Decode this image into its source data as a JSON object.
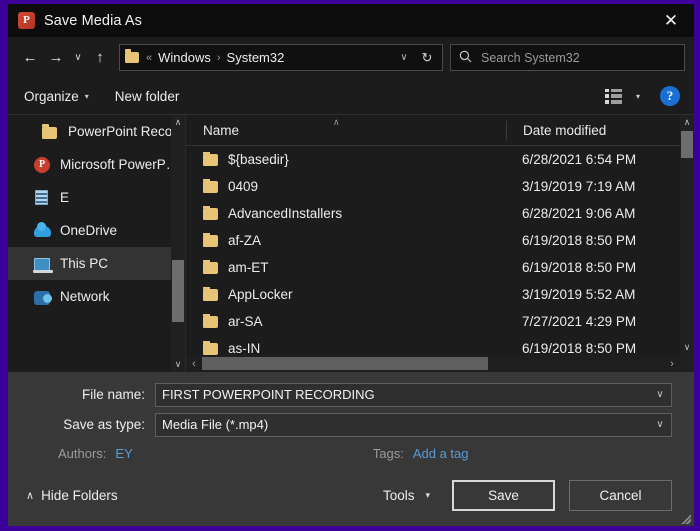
{
  "window": {
    "title": "Save Media As",
    "app_icon": "powerpoint-icon",
    "app_icon_letter": "P",
    "close_label": "✕",
    "accent_border": "#3d0099"
  },
  "nav": {
    "back": "←",
    "forward": "→",
    "recent": "∨",
    "up": "↑",
    "address": {
      "folder_icon": "folder-icon",
      "separator_first": "«",
      "separator": "›",
      "crumbs": [
        "Windows",
        "System32"
      ],
      "dropdown": "∨",
      "refresh": "↻"
    },
    "search": {
      "icon": "search-icon",
      "placeholder": "Search System32",
      "value": ""
    }
  },
  "toolbar": {
    "organize_label": "Organize",
    "organize_caret": "▾",
    "new_folder_label": "New folder",
    "view_icon": "list-view-icon",
    "view_caret": "▾",
    "help_label": "?"
  },
  "sidebar": {
    "scroll_up": "∧",
    "scroll_down": "∨",
    "items": [
      {
        "label": "PowerPoint Reco",
        "icon": "folder-icon",
        "selected": false,
        "chevron": "∧"
      },
      {
        "label": "Microsoft PowerP…",
        "icon": "powerpoint-icon",
        "selected": false,
        "chevron": ""
      },
      {
        "label": "E",
        "icon": "network-drive-icon",
        "selected": false,
        "chevron": ""
      },
      {
        "label": "OneDrive",
        "icon": "onedrive-icon",
        "selected": false,
        "chevron": ""
      },
      {
        "label": "This PC",
        "icon": "this-pc-icon",
        "selected": true,
        "chevron": ""
      },
      {
        "label": "Network",
        "icon": "network-icon",
        "selected": false,
        "chevron": ""
      }
    ]
  },
  "filelist": {
    "columns": [
      "Name",
      "Date modified"
    ],
    "sort_indicator": "∧",
    "rows": [
      {
        "name": "${basedir}",
        "date": "6/28/2021 6:54 PM"
      },
      {
        "name": "0409",
        "date": "3/19/2019 7:19 AM"
      },
      {
        "name": "AdvancedInstallers",
        "date": "6/28/2021 9:06 AM"
      },
      {
        "name": "af-ZA",
        "date": "6/19/2018 8:50 PM"
      },
      {
        "name": "am-ET",
        "date": "6/19/2018 8:50 PM"
      },
      {
        "name": "AppLocker",
        "date": "3/19/2019 5:52 AM"
      },
      {
        "name": "ar-SA",
        "date": "7/27/2021 4:29 PM"
      },
      {
        "name": "as-IN",
        "date": "6/19/2018 8:50 PM"
      }
    ],
    "hscroll_left": "‹",
    "hscroll_right": "›",
    "vscroll_up": "∧",
    "vscroll_down": "∨"
  },
  "form": {
    "file_name_label": "File name:",
    "file_name_value": "FIRST POWERPOINT RECORDING",
    "save_as_type_label": "Save as type:",
    "save_as_type_value": "Media File (*.mp4)",
    "combo_caret": "∨",
    "authors_label": "Authors:",
    "authors_value": "EY",
    "tags_label": "Tags:",
    "tags_value": "Add a tag",
    "link_color": "#5b9bd5"
  },
  "footer": {
    "hide_folders_caret": "∧",
    "hide_folders_label": "Hide Folders",
    "tools_label": "Tools",
    "tools_caret": "▾",
    "save_label": "Save",
    "cancel_label": "Cancel"
  }
}
